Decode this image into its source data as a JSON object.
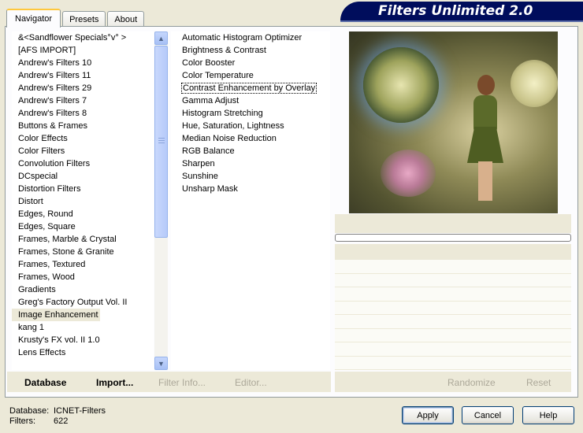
{
  "tabs": [
    {
      "label": "Navigator",
      "active": true
    },
    {
      "label": "Presets",
      "active": false
    },
    {
      "label": "About",
      "active": false
    }
  ],
  "banner_title": "Filters Unlimited 2.0",
  "categories": [
    "&<Sandflower Specials°v° >",
    "[AFS IMPORT]",
    "Andrew's Filters 10",
    "Andrew's Filters 11",
    "Andrew's Filters 29",
    "Andrew's Filters 7",
    "Andrew's Filters 8",
    "Buttons & Frames",
    "Color Effects",
    "Color Filters",
    "Convolution Filters",
    "DCspecial",
    "Distortion Filters",
    "Distort",
    "Edges, Round",
    "Edges, Square",
    "Frames, Marble & Crystal",
    "Frames, Stone & Granite",
    "Frames, Textured",
    "Frames, Wood",
    "Gradients",
    "Greg's Factory Output Vol. II",
    "Image Enhancement",
    "kang 1",
    "Krusty's FX vol. II 1.0",
    "Lens Effects"
  ],
  "selected_category": "Image Enhancement",
  "filters": [
    "Automatic Histogram Optimizer",
    "Brightness & Contrast",
    "Color Booster",
    "Color Temperature",
    "Contrast Enhancement by Overlay",
    "Gamma Adjust",
    "Histogram Stretching",
    "Hue, Saturation, Lightness",
    "Median Noise Reduction",
    "RGB Balance",
    "Sharpen",
    "Sunshine",
    "Unsharp Mask"
  ],
  "focused_filter": "Contrast Enhancement by Overlay",
  "toolbar": {
    "database": "Database",
    "import": "Import...",
    "filter_info": "Filter Info...",
    "editor": "Editor...",
    "randomize": "Randomize",
    "reset": "Reset"
  },
  "status": {
    "database_label": "Database:",
    "database_value": "ICNET-Filters",
    "filters_label": "Filters:",
    "filters_value": "622"
  },
  "buttons": {
    "apply": "Apply",
    "cancel": "Cancel",
    "help": "Help"
  },
  "colors": {
    "banner": "#000d5c",
    "window": "#ece9d8"
  }
}
